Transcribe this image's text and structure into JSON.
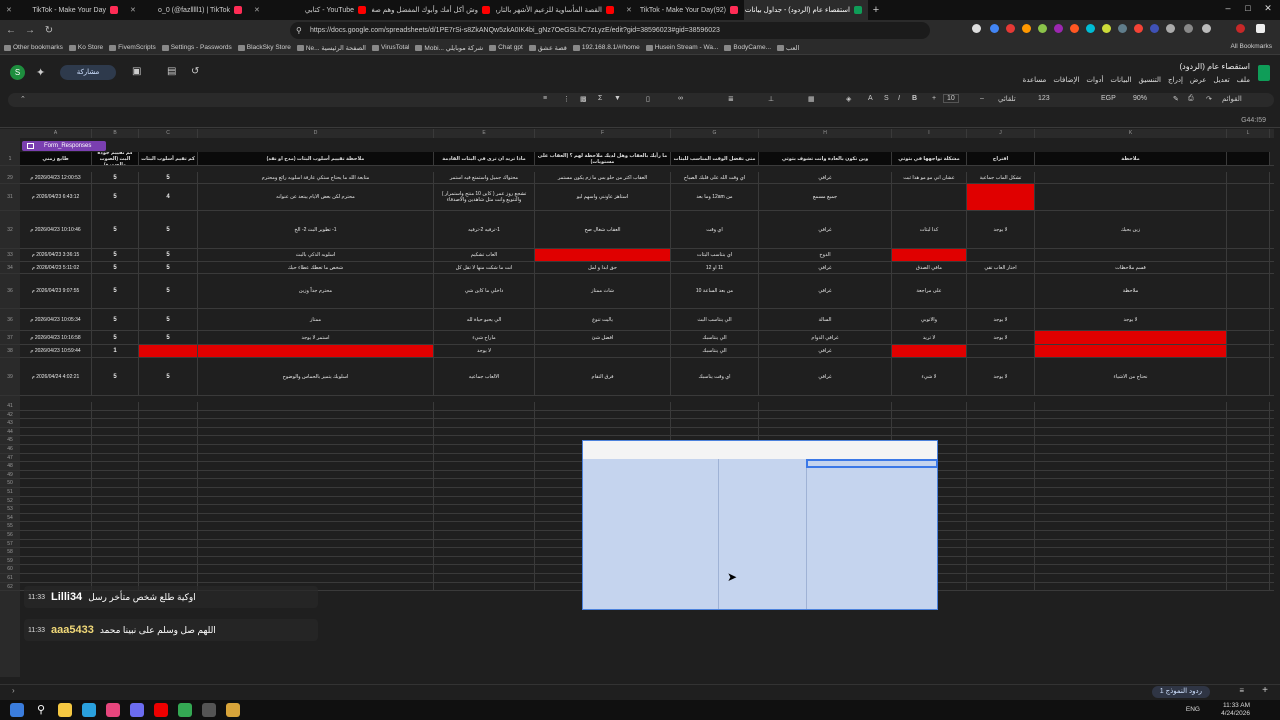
{
  "browser": {
    "tabs": [
      {
        "title": "TikTok - Make Your Day",
        "color": "#fe2c55"
      },
      {
        "title": "o_0 (@fazlllll1) | TikTok",
        "color": "#fe2c55"
      },
      {
        "title": "YouTube - كتابي",
        "color": "#ff0000"
      },
      {
        "title": "وش أكل أمك وأبوك المفضل وهم صغار",
        "color": "#ff0000"
      },
      {
        "title": "القصة المأساوية للزعيم الأشهر بالتاريخ",
        "color": "#ff0000"
      },
      {
        "title": "(92)TikTok - Make Your Day",
        "color": "#fe2c55"
      },
      {
        "title": "استقصاء عام (الردود) - جداول بيانات",
        "color": "#0f9d58",
        "active": true
      }
    ],
    "url": "https://docs.google.com/spreadsheets/d/1PE7rSi-s8ZkANQw5zkA0IK4bi_gNz7OeGSLhC7zLyzE/edit?gid=38596023#gid=38596023",
    "bookmarks": [
      "Other bookmarks",
      "Ko Store",
      "FivemScripts",
      "Settings - Passwords",
      "BlackSky Store",
      "Ne... الصفحة الرئيسية",
      "VirusTotal",
      "Mobi... شركة موبايلي",
      "Chat gpt",
      "قصة عشق",
      "192.168.8.1/#/home",
      "Husein Stream - Wa...",
      "BodyCame...",
      "العب"
    ],
    "all_bookmarks": "All Bookmarks"
  },
  "sheets": {
    "title": "استقصاء عام (الردود)",
    "share_label": "مشاركة",
    "avatar_letter": "S",
    "menus": [
      "ملف",
      "تعديل",
      "عرض",
      "إدراج",
      "التنسيق",
      "البيانات",
      "أدوات",
      "الإضافات",
      "مساعدة"
    ],
    "cell_ref": "G44:I59",
    "zoom": "90%",
    "font_size": "10",
    "default_font": "تلقائي",
    "currency": "EGP",
    "menus_label": "القوائم",
    "sheet_tab": "ردود النموذج 1",
    "table_badge": "Form_Responses"
  },
  "grid": {
    "columns": [
      "A",
      "B",
      "C",
      "D",
      "E",
      "F",
      "G",
      "H",
      "I",
      "J",
      "K",
      "L"
    ],
    "headers": [
      "طابع زمني",
      "كم تقييم جودة البث (الصوت والصورة)",
      "كم تقيم أسلوب البثات",
      "ملاحظة تقييم أسلوب البثات (مدح او نقد)",
      "ماذا تريد ان ترى في البثات القادمة",
      "ما رأيك بالعقاب وهل لديك ملاحظة لهم ؟ (العقاب على مستويات)",
      "متى تفضل الوقت المناسب للبثات",
      "وين تكون بالعادة وانت تشوف بثوثي",
      "مشكلة تواجهها في بثوثي",
      "اقتراح",
      "ملاحظة"
    ],
    "rows": [
      {
        "n": "29",
        "cells": [
          "12:00:53 2026/04/23 م",
          "5",
          "5",
          "متابعة الله ما يحتاج ستكي عارفة اسلوبه رائع ومحترم",
          "محتواك جميل واستمتع فيه استمر",
          "العقاب اكثر من حلو بس ما زم يكون مستمر",
          "اي وقت الله على قلبك الصباح",
          "غرافي",
          "عشان اني مو مو هذا ثبت",
          "تشكل الماب جماعية",
          ""
        ]
      },
      {
        "n": "31",
        "cells": [
          "6:43:12 2026/04/23 م",
          "5",
          "4",
          "محترم لكن بعض الايام يبتعد عن عنوانه",
          "تشجع روز عمر ( كاين 10 منتج واستمرار ) والتنويع وانت مثل شاهدين والاصدقاء",
          "استاهز عاونني واسهم ليو",
          "من 12am وما بعد",
          "جميع مسمع",
          "",
          "",
          ""
        ]
      },
      {
        "n": "32",
        "cells": [
          "10:10:46 2026/04/23 م",
          "5",
          "5",
          "1- تطوير البث 2- الخ",
          "1-ترفيه 2-ترفيه",
          "العقاب شغال صح",
          "اي وقت",
          "غرافي",
          "كذا لبثات",
          "لا يوجد",
          "زين بحبك"
        ]
      },
      {
        "n": "33",
        "cells": [
          "3:36:15 2026/04/23 م",
          "5",
          "5",
          "اسلوبه الذكي بالبث",
          "العاب تشكيم",
          "",
          "اي بنتاسب البثات",
          "الدوخ",
          "",
          "",
          ""
        ]
      },
      {
        "n": "34",
        "cells": [
          "5:11:02 2026/04/23 م",
          "5",
          "5",
          "شخص ما تعطك عطاء حبك",
          "انت ما شكت منها لا تقل كل",
          "حق ابدا و لمل",
          "11 او 12",
          "غرافي",
          "مافي الصدق",
          "اختار العاب تقي",
          "قسم ملاحظات"
        ]
      },
      {
        "n": "36",
        "cells": [
          "9:07:55 2026/04/23 م",
          "5",
          "5",
          "محترم جداً وزين",
          "داخلي ما كاين شي",
          "شاث ممتاز",
          "من بعد الساعة 10",
          "غرافي",
          "على مراجعة",
          "",
          "ملاحظة"
        ]
      },
      {
        "n": "36",
        "cells": [
          "10:05:34 2026/04/23 م",
          "5",
          "5",
          "ممتاز",
          "الي يحبو حياة لله",
          "ياليت تنوع",
          "الي ينتاسب البث",
          "السالة",
          "والاتوبي",
          "لا يوجد",
          "لا يوجد"
        ]
      },
      {
        "n": "37",
        "cells": [
          "10:16:58 2026/04/23 م",
          "5",
          "5",
          "استمر لا يوجد",
          "ماراح شيء",
          "افضل شئ",
          "الي ينتاسبك",
          "غرافي الدوام",
          "لا تريد",
          "لا يوجد",
          ""
        ]
      },
      {
        "n": "38",
        "cells": [
          "10:59:44 2026/04/23 م",
          "1",
          "",
          "",
          "لا يوجد",
          "",
          "الي ينتاسبك",
          "غرافي",
          "",
          "",
          ""
        ]
      },
      {
        "n": "39",
        "cells": [
          "4:02:21 2026/04/24 م",
          "5",
          "5",
          "اسلوبك يتميز بالحماس والوضوح",
          "الالعاب جماعيه",
          "فرق التقام",
          "اي وقت يناسبك",
          "غرافي",
          "لا شيء",
          "لا يوجد",
          "نحتاج من الاشياء"
        ]
      }
    ],
    "red_cells": [
      [
        1,
        9
      ],
      [
        3,
        5
      ],
      [
        3,
        8
      ],
      [
        7,
        10
      ],
      [
        8,
        2
      ],
      [
        8,
        3
      ],
      [
        8,
        8
      ],
      [
        8,
        10
      ]
    ],
    "empty_rows": [
      "41",
      "42",
      "43",
      "44",
      "45",
      "46",
      "47",
      "48",
      "49",
      "50",
      "51",
      "52",
      "53",
      "54",
      "55",
      "56",
      "57",
      "58",
      "59",
      "60",
      "61",
      "62"
    ]
  },
  "chat": [
    {
      "time": "11:33",
      "user": "Lilli34",
      "message": "اوكية طلع شخص متأخر رسل"
    },
    {
      "time": "11:33",
      "user": "aaa5433",
      "message": "اللهم صل وسلم على نبينا محمد"
    }
  ],
  "taskbar": {
    "lang": "ENG",
    "time": "11:33 AM",
    "date": "4/24/2026"
  }
}
